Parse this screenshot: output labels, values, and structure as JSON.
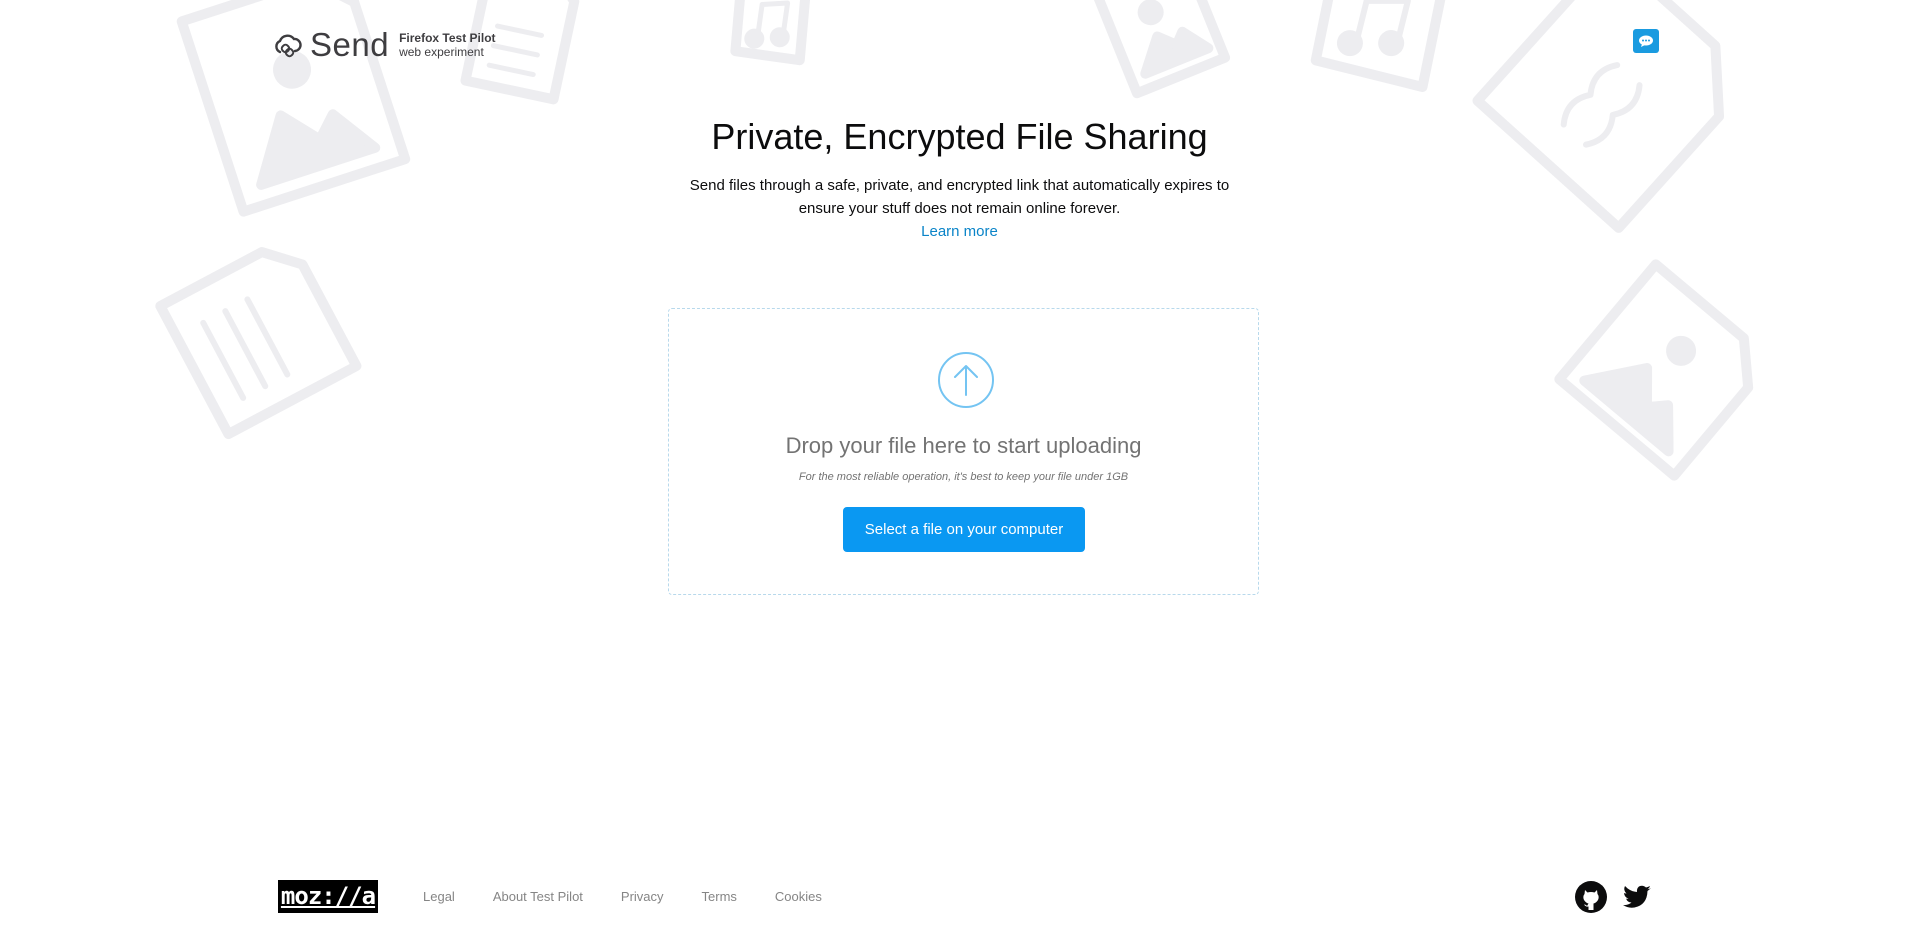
{
  "header": {
    "app_name": "Send",
    "subtitle_top": "Firefox Test Pilot",
    "subtitle_bottom": "web experiment",
    "feedback_icon": "chat-bubble-icon"
  },
  "hero": {
    "title": "Private, Encrypted File Sharing",
    "intro": "Send files through a safe, private, and encrypted link that automatically expires to ensure your stuff does not remain online forever.",
    "learn_more": "Learn more"
  },
  "upload": {
    "icon": "upload-arrow-icon",
    "title": "Drop your file here to start uploading",
    "note": "For the most reliable operation, it's best to keep your file under 1GB",
    "button": "Select a file on your computer"
  },
  "footer": {
    "logo_text": "moz://a",
    "links": [
      "Legal",
      "About Test Pilot",
      "Privacy",
      "Terms",
      "Cookies"
    ],
    "social_icons": [
      "github-icon",
      "twitter-icon"
    ]
  },
  "colors": {
    "accent": "#0a98f2",
    "link": "#0a84c8",
    "feedback": "#1a9be0",
    "background_shapes": "#ededf0"
  }
}
